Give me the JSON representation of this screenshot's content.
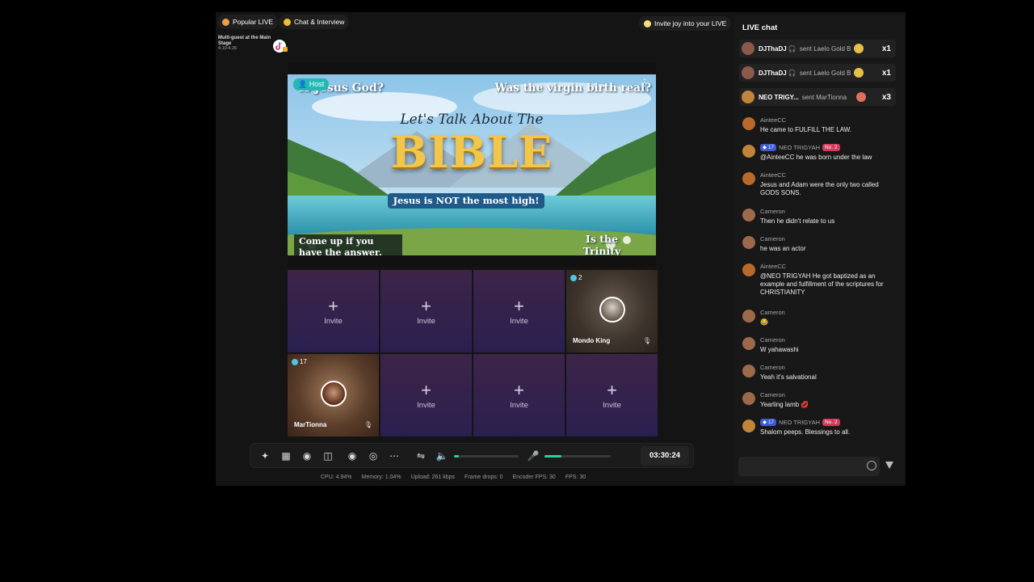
{
  "topbar": {
    "popular_live": "Popular LIVE",
    "chat_interview": "Chat & Interview",
    "stage_title": "Multi-guest at the Main Stage",
    "stage_dates": "4.10-4.26",
    "invite_joy": "Invite joy into your LIVE"
  },
  "host": {
    "badge": "Host",
    "more_icon": "more-vertical-icon",
    "banner": {
      "q1": "Is Jesus God?",
      "q2": "Was the virgin birth real?",
      "lets_talk": "Let's Talk About The",
      "bible": "BIBLE",
      "not_most_high": "Jesus is NOT the most high!",
      "come_up": "Come up if you have the answer.",
      "trinity": "Is the Trinity biblical?"
    }
  },
  "grid": {
    "invite_label": "Invite",
    "plus": "+",
    "guest1": {
      "num": "2",
      "name": "Mondo King"
    },
    "guest2": {
      "num": "17",
      "name": "MarTionna"
    }
  },
  "controls": {
    "timer": "03:30:24",
    "volume_level": 0.08,
    "mic_level": 0.25
  },
  "stats": {
    "cpu": "CPU: 4.94%",
    "memory": "Memory: 1.04%",
    "upload": "Upload: 261 kbps",
    "frame_drops": "Frame drops: 0",
    "encoder_fps": "Encoder FPS: 30",
    "fps": "FPS: 30"
  },
  "chat": {
    "title": "LIVE chat",
    "gifts": [
      {
        "user": "DJThaDJ 🎧",
        "sent": "sent Laelo Gold B",
        "count": "x1"
      },
      {
        "user": "DJThaDJ 🎧",
        "sent": "sent Laelo Gold B",
        "count": "x1"
      },
      {
        "user": "NEO TRIGY...",
        "sent": "sent MarTionna",
        "count": "x3"
      }
    ],
    "messages": [
      {
        "user": "AinteeCC",
        "text": "He came to FULFILL THE LAW."
      },
      {
        "user": "NEO TRIGYAH",
        "level": "17",
        "rank": "No. 2",
        "text": "@AinteeCC he was born under the law"
      },
      {
        "user": "AinteeCC",
        "text": "Jesus and Adam were the only two called GODS SONS."
      },
      {
        "user": "Cameron",
        "text": "Then he didn't relate to us"
      },
      {
        "user": "Cameron",
        "text": "he was an actor"
      },
      {
        "user": "AinteeCC",
        "text": "@NEO TRIGYAH He got baptized as an example and fulfillment of the scriptures for CHRISTIANITY"
      },
      {
        "user": "Cameron",
        "text": "😂"
      },
      {
        "user": "Cameron",
        "text": "W yahawashi"
      },
      {
        "user": "Cameron",
        "text": "Yeah it's salvational"
      },
      {
        "user": "Cameron",
        "text": "Yearling lamb 💋"
      },
      {
        "user": "NEO TRIGYAH",
        "level": "17",
        "rank": "No. 2",
        "text": "Shalom peeps. Blessings to all."
      }
    ]
  }
}
